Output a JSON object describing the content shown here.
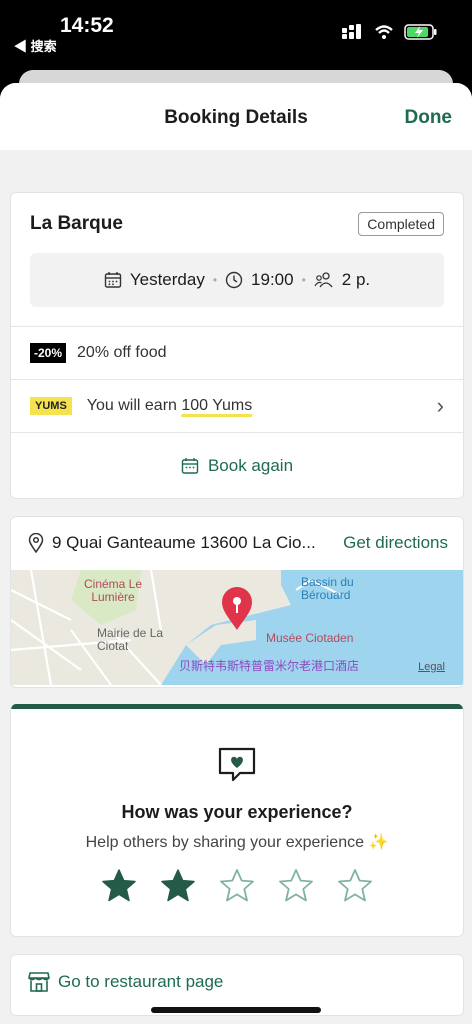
{
  "status_bar": {
    "time": "14:52",
    "back_label": "◀ 搜索"
  },
  "header": {
    "title": "Booking Details",
    "done_label": "Done"
  },
  "booking": {
    "restaurant": "La Barque",
    "status": "Completed",
    "date": "Yesterday",
    "time": "19:00",
    "party": "2 p.",
    "discount_tag": "-20%",
    "discount_text": "20% off food",
    "yums_tag": "YUMS",
    "yums_prefix": "You will earn ",
    "yums_value": "100 Yums",
    "book_again": "Book again"
  },
  "location": {
    "address": "9 Quai Ganteaume 13600 La Cio...",
    "directions_label": "Get directions",
    "map_labels": {
      "cinema": "Cinéma Le Lumière",
      "basin": "Bassin du Bérouard",
      "museum": "Musée Ciotaden",
      "mairie": "Mairie de La Ciotat",
      "hotel": "贝斯特韦斯特普雷米尔老港口酒店",
      "legal": "Legal"
    }
  },
  "feedback": {
    "title": "How was your experience?",
    "subtitle": "Help others by sharing your experience ✨",
    "rating": 2,
    "max_rating": 5
  },
  "footer": {
    "restaurant_page_label": "Go to restaurant page"
  },
  "colors": {
    "accent": "#1f6b4f",
    "star_filled": "#245b48",
    "star_empty": "#7fb3a0",
    "yums_yellow": "#f5e24f"
  }
}
